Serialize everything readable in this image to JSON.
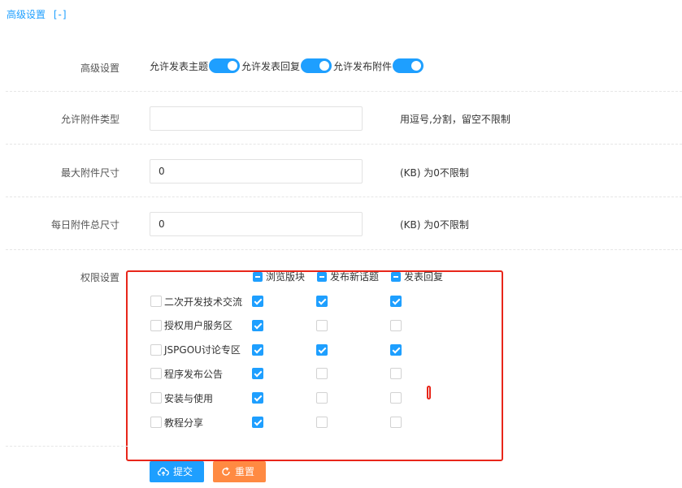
{
  "section": {
    "title": "高级设置",
    "toggle": "[-]"
  },
  "advanced": {
    "label": "高级设置",
    "switches": [
      {
        "label": "允许发表主题",
        "on": true
      },
      {
        "label": "允许发表回复",
        "on": true
      },
      {
        "label": "允许发布附件",
        "on": true
      }
    ]
  },
  "attach_types": {
    "label": "允许附件类型",
    "value": "",
    "hint": "用逗号,分割，留空不限制"
  },
  "max_size": {
    "label": "最大附件尺寸",
    "value": "0",
    "hint": "(KB) 为0不限制"
  },
  "daily_size": {
    "label": "每日附件总尺寸",
    "value": "0",
    "hint": "(KB) 为0不限制"
  },
  "permissions": {
    "label": "权限设置",
    "columns": [
      "浏览版块",
      "发布新话题",
      "发表回复"
    ],
    "forums": [
      {
        "name": "二次开发技术交流",
        "perms": [
          true,
          true,
          true
        ]
      },
      {
        "name": "授权用户服务区",
        "perms": [
          true,
          false,
          false
        ]
      },
      {
        "name": "JSPGOU讨论专区",
        "perms": [
          true,
          true,
          true
        ]
      },
      {
        "name": "程序发布公告",
        "perms": [
          true,
          false,
          false
        ]
      },
      {
        "name": "安装与使用",
        "perms": [
          true,
          false,
          false
        ]
      },
      {
        "name": "教程分享",
        "perms": [
          true,
          false,
          false
        ]
      }
    ]
  },
  "buttons": {
    "submit": "提交",
    "reset": "重置"
  },
  "colors": {
    "primary": "#1e9fff",
    "reset": "#ff8a42",
    "highlight": "#e8261a"
  },
  "icons": {
    "submit": "cloud-upload-icon",
    "reset": "refresh-icon"
  }
}
